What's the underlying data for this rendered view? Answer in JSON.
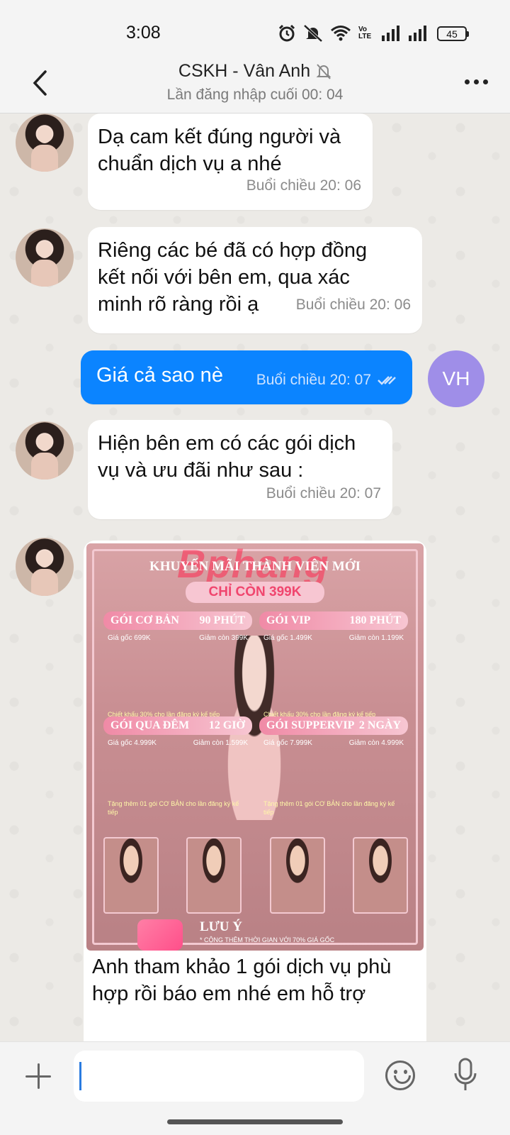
{
  "status_bar": {
    "time": "3:08",
    "battery": "45",
    "network_label": "Vo LTE"
  },
  "header": {
    "title": "CSKH - Vân Anh",
    "subtitle": "Lần đăng nhập cuối 00: 04"
  },
  "messages": [
    {
      "sender": "other",
      "text": "Dạ cam kết đúng người và chuẩn dịch vụ a nhé",
      "time": "Buổi chiều  20: 06"
    },
    {
      "sender": "other",
      "text": "Riêng các bé đã có hợp đồng kết nối với bên em, qua xác minh rõ ràng rồi ạ",
      "time": "Buổi chiều  20: 06"
    },
    {
      "sender": "me",
      "text": "Giá cả sao nè",
      "time": "Buổi chiều  20: 07",
      "avatar_initials": "VH"
    },
    {
      "sender": "other",
      "text": "Hiện bên em có các gói dịch vụ và ưu đãi như sau :",
      "time": "Buổi chiều  20: 07"
    },
    {
      "sender": "other",
      "type": "image",
      "caption": "Anh tham khảo 1 gói dịch vụ phù hợp rồi báo em nhé em hỗ trợ"
    }
  ],
  "promo": {
    "watermark": "Bphang",
    "title": "KHUYẾN MÃI THÀNH VIÊN MỚI",
    "price": "CHỈ CÒN 399K",
    "packages": [
      {
        "name": "GÓI CƠ BẢN",
        "duration": "90 PHÚT",
        "original": "Giá gốc 699K",
        "discount": "Giảm còn 399K",
        "note": "Chiết khấu 30% cho lần đăng ký kế tiếp"
      },
      {
        "name": "GÓI VIP",
        "duration": "180 PHÚT",
        "original": "Giá gốc 1.499K",
        "discount": "Giảm còn 1.199K",
        "note": "Chiết khấu 30% cho lần đăng ký kế tiếp"
      },
      {
        "name": "GÓI QUA ĐÊM",
        "duration": "12 GIỜ",
        "original": "Giá gốc 4.999K",
        "discount": "Giảm còn 1.599K",
        "note": "Tặng thêm 01 gói CƠ BẢN cho lần đăng ký kế tiếp"
      },
      {
        "name": "GÓI SUPPERVIP",
        "duration": "2 NGÀY",
        "original": "Giá gốc 7.999K",
        "discount": "Giảm còn 4.999K",
        "note": "Tặng thêm 01 gói CƠ BẢN cho lần đăng ký kế tiếp"
      }
    ],
    "luu_y": "LƯU Ý",
    "footer_note": "* CỘNG THÊM THỜI GIAN VỚI 70% GIÁ GỐC"
  },
  "input": {
    "placeholder": ""
  },
  "icons": {
    "back": "chevron-left-icon",
    "mute": "bell-off-icon",
    "more": "more-horizontal-icon",
    "plus": "plus-icon",
    "emoji": "smiley-icon",
    "mic": "microphone-icon"
  },
  "colors": {
    "my_bubble": "#0b84ff",
    "my_avatar": "#9f8ee8"
  }
}
